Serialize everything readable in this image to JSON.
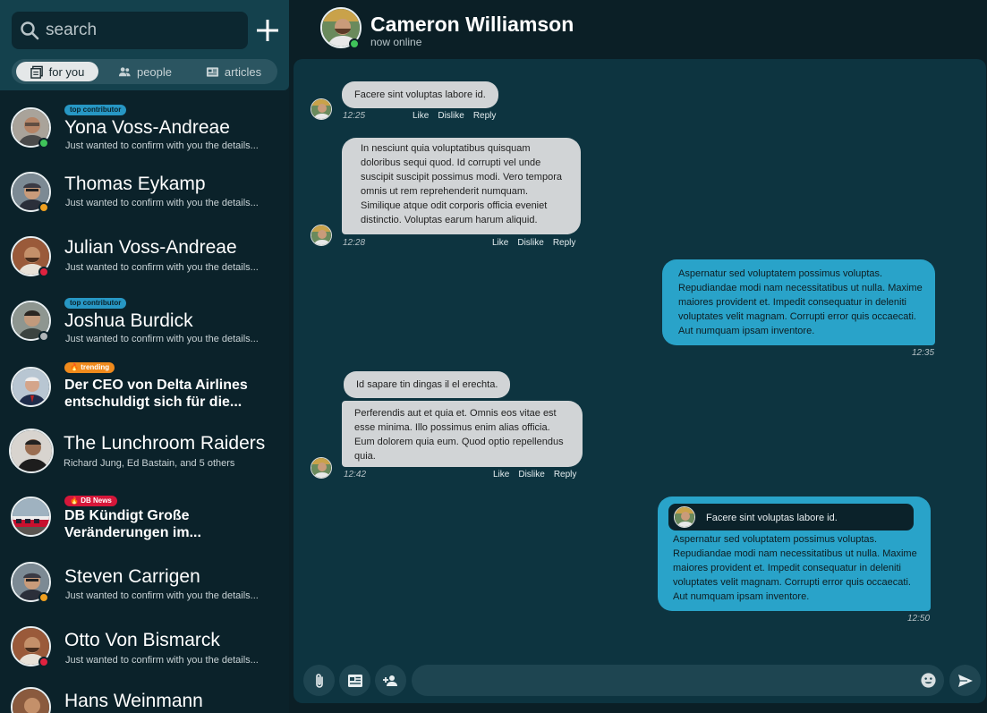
{
  "sidebar": {
    "search": {
      "placeholder": "search"
    },
    "tabs": [
      {
        "label": "for you",
        "icon": "feed-icon",
        "active": true
      },
      {
        "label": "people",
        "icon": "people-icon",
        "active": false
      },
      {
        "label": "articles",
        "icon": "article-icon",
        "active": false
      }
    ],
    "conversations": [
      {
        "name": "Yona Voss-Andreae",
        "preview": "Just wanted to confirm with you the details...",
        "badge": "top contributor",
        "status": "online"
      },
      {
        "name": "Thomas Eykamp",
        "preview": "Just wanted to confirm with you the details...",
        "status": "away"
      },
      {
        "name": "Julian Voss-Andreae",
        "preview": "Just wanted to confirm with you the details...",
        "status": "busy"
      },
      {
        "name": "Joshua Burdick",
        "preview": "Just wanted to confirm with you the details...",
        "badge": "top contributor",
        "status": "offline"
      },
      {
        "name": "Der CEO von Delta Airlines entschuldigt sich für die...",
        "badge": "trending"
      },
      {
        "name": "The Lunchroom Raiders",
        "preview": "Richard Jung, Ed Bastain, and 5 others"
      },
      {
        "name": "DB Kündigt Große Veränderungen im...",
        "badge": "DB News"
      },
      {
        "name": "Steven Carrigen",
        "preview": "Just wanted to confirm with you the details...",
        "status": "away"
      },
      {
        "name": "Otto Von Bismarck",
        "preview": "Just wanted to confirm with you the details...",
        "status": "busy"
      },
      {
        "name": "Hans Weinmann"
      }
    ]
  },
  "header": {
    "name": "Cameron Williamson",
    "status_text": "now online"
  },
  "messages": [
    {
      "text": "Facere sint voluptas labore id.",
      "time": "12:25",
      "like": "Like",
      "dislike": "Dislike",
      "reply": "Reply"
    },
    {
      "lines": [
        "In nesciunt quia voluptatibus quisquam",
        "doloribus sequi quod. Id corrupti vel unde",
        "suscipit suscipit possimus modi. Vero tempora",
        "omnis ut rem reprehenderit numquam.",
        "Similique atque odit corporis officia eveniet",
        "distinctio. Voluptas earum harum aliquid."
      ],
      "time": "12:28",
      "like": "Like",
      "dislike": "Dislike",
      "reply": "Reply"
    },
    {
      "lines": [
        "Aspernatur sed voluptatem possimus voluptas.",
        "Repudiandae modi nam necessitatibus ut nulla. Maxime",
        "maiores provident et. Impedit consequatur in deleniti",
        "voluptates velit magnam. Corrupti error quis occaecati.",
        "Aut numquam ipsam inventore."
      ],
      "time": "12:35"
    },
    {
      "text": "Id sapare tin dingas il el erechta.",
      "lines": [
        "Perferendis aut et quia et. Omnis eos vitae est",
        "esse minima. Illo possimus enim alias officia.",
        "Eum dolorem quia eum. Quod optio repellendus",
        "quia."
      ],
      "time": "12:42",
      "like": "Like",
      "dislike": "Dislike",
      "reply": "Reply"
    },
    {
      "quote": "Facere sint voluptas labore id.",
      "lines": [
        "Aspernatur sed voluptatem possimus voluptas.",
        "Repudiandae modi nam necessitatibus ut nulla. Maxime",
        "maiores provident et. Impedit consequatur in deleniti",
        "voluptates velit magnam. Corrupti error quis occaecati.",
        "Aut numquam ipsam inventore."
      ],
      "time": "12:50"
    }
  ],
  "composer": {
    "placeholder": ""
  },
  "colors": {
    "accent": "#29a3c9",
    "online": "#3fc45a",
    "away": "#f0a020",
    "busy": "#e0223f",
    "offline": "#b0b6b8",
    "badge_blue": "#2797c4",
    "badge_orange": "#f08a1c",
    "badge_red": "#d6173a"
  }
}
